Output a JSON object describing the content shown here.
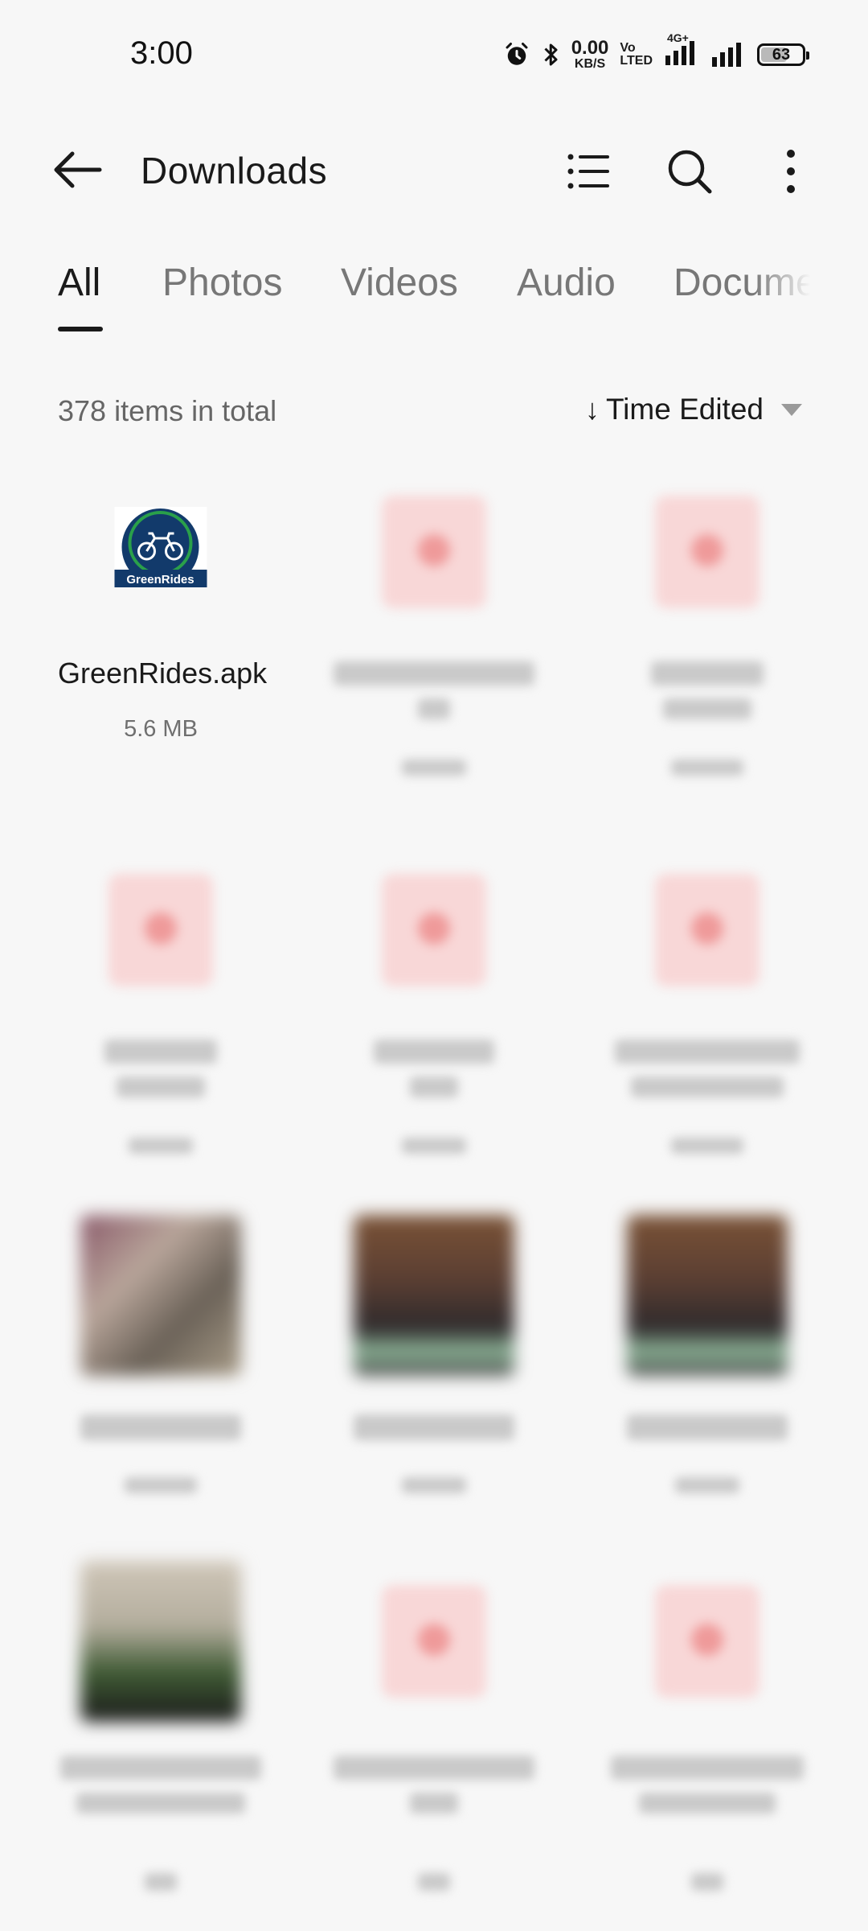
{
  "status_bar": {
    "time": "3:00",
    "net_speed_value": "0.00",
    "net_speed_unit": "KB/S",
    "volte_top": "Vo",
    "volte_bottom": "LTED",
    "network": "4G+",
    "battery": "63",
    "battery_level": 0.63,
    "icons": [
      "alarm-icon",
      "bluetooth-icon",
      "signal-icon",
      "signal-icon",
      "battery-icon"
    ]
  },
  "header": {
    "title": "Downloads",
    "icons": [
      "back-arrow-icon",
      "list-view-icon",
      "search-icon",
      "more-vert-icon"
    ]
  },
  "tabs": [
    {
      "label": "All",
      "active": true
    },
    {
      "label": "Photos",
      "active": false
    },
    {
      "label": "Videos",
      "active": false
    },
    {
      "label": "Audio",
      "active": false
    },
    {
      "label": "Docume",
      "active": false
    }
  ],
  "summary": {
    "count_text": "378 items in total",
    "sort_label": "Time Edited"
  },
  "files": [
    {
      "name": "GreenRides.apk",
      "size": "5.6 MB",
      "type": "apk",
      "icon_text": "GreenRides"
    },
    {
      "type": "pdf-blurred"
    },
    {
      "type": "pdf-blurred"
    },
    {
      "type": "pdf-blurred"
    },
    {
      "type": "pdf-blurred"
    },
    {
      "type": "pdf-blurred"
    },
    {
      "type": "photo-blurred"
    },
    {
      "type": "photo-blurred"
    },
    {
      "type": "photo-blurred"
    },
    {
      "type": "photo-blurred"
    },
    {
      "type": "pdf-blurred"
    },
    {
      "type": "pdf-blurred"
    }
  ],
  "colors": {
    "background": "#f7f7f7",
    "text_primary": "#1a1a1a",
    "text_secondary": "#666666",
    "pdf_icon": "#f8d7d7",
    "apk_brand": "#123a6b",
    "apk_ring": "#2aa04a"
  }
}
